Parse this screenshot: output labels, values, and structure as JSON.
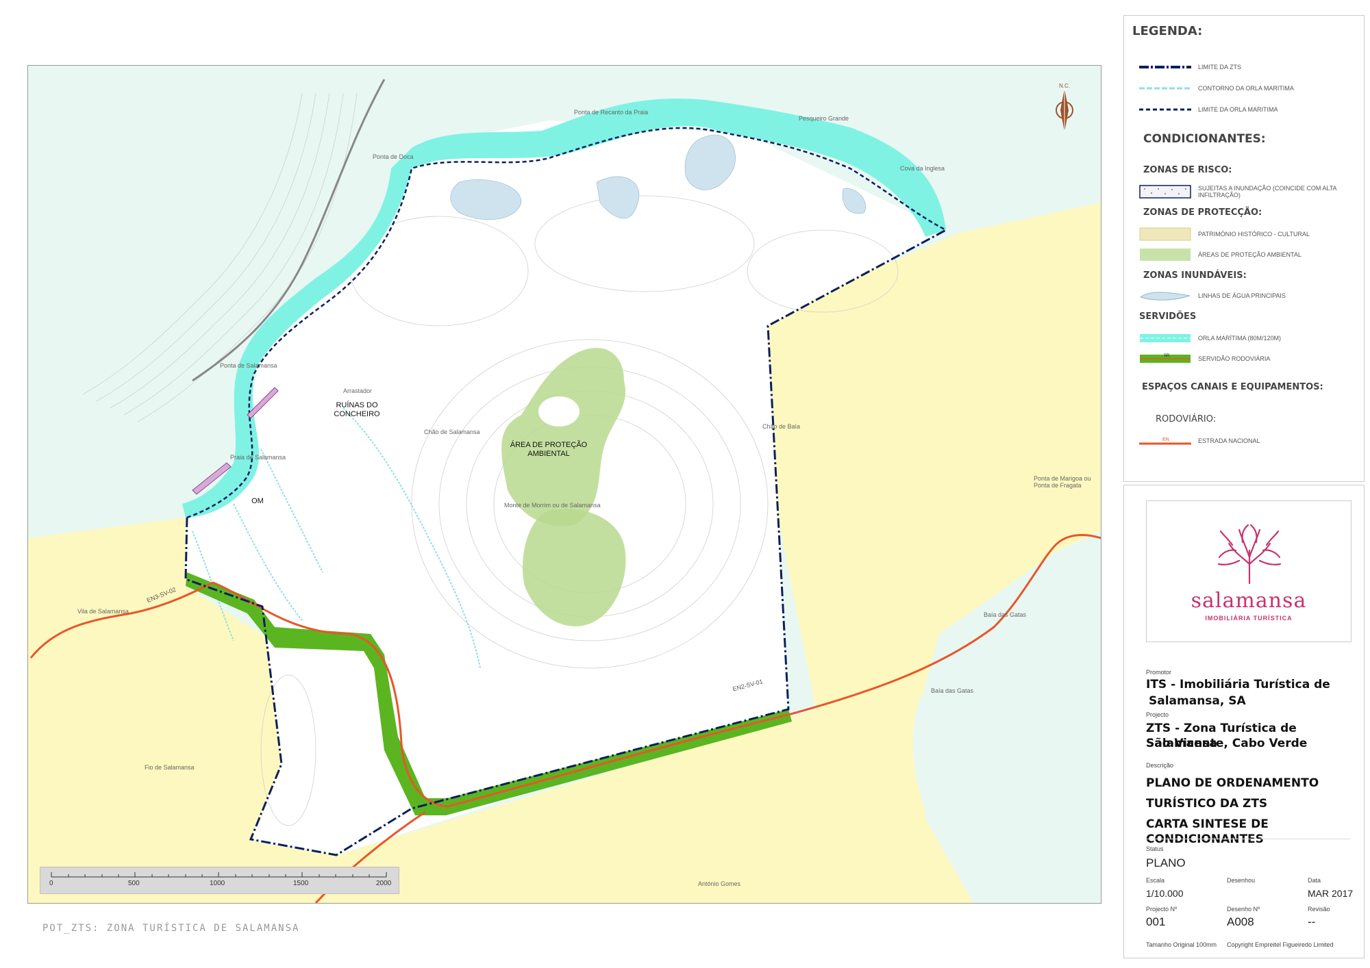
{
  "drawing_title": "POT_ZTS: ZONA TURÍSTICA DE SALAMANSA",
  "north_label": "N.C.",
  "map": {
    "places": {
      "ponta_recanto": "Ponta de Recanto da Praia",
      "pesqueiro": "Pesqueiro Grande",
      "ponta_doca": "Ponta de Doca",
      "cova_inglesa": "Cova da Inglesa",
      "ponta_salamansa": "Ponta de Salamansa",
      "arrastador": "Arrastador",
      "chao_salamansa": "Chão de Salamansa",
      "chao_baia": "Chão de Baía",
      "praia_salamansa": "Praia de Salamansa",
      "monte": "Monte de Morrim ou de Salamansa",
      "ponta_marigoa": "Ponta de Marigoa ou Ponta de Fragata",
      "vila": "Vila de Salamansa",
      "baia_gatas_1": "Baía das Gatas",
      "baia_gatas_2": "Baía das Gatas",
      "fio": "Fio de Salamansa",
      "antonio": "António Gomes"
    },
    "labels": {
      "ruinas": "RUÍNAS DO CONCHEIRO",
      "area_protecao": "ÁREA DE PROTEÇÃO AMBIENTAL",
      "om": "OM"
    },
    "roads": {
      "en3": "EN3-SV-02",
      "en2": "EN2-SV-01"
    },
    "scale_ticks": [
      "0",
      "500",
      "1000",
      "1500",
      "2000"
    ]
  },
  "legend": {
    "title": "LEGENDA:",
    "items_top": [
      {
        "label": "LIMITE DA ZTS"
      },
      {
        "label": "CONTORNO DA ORLA MARITIMA"
      },
      {
        "label": "LIMITE DA ORLA MARITIMA"
      }
    ],
    "condicionantes": "CONDICIONANTES:",
    "zonas_risco": "ZONAS DE RISCO:",
    "risco_item": "SUJEITAS A INUNDAÇÃO (COINCIDE COM ALTA INFILTRAÇÃO)",
    "zonas_protecao": "ZONAS DE PROTECÇÃO:",
    "patrimonio": "PATRIMÓNIO HISTÓRICO - CULTURAL",
    "areas_protecao": "ÁREAS DE PROTEÇÃO AMBIENTAL",
    "zonas_inundaveis": "ZONAS INUNDÁVEIS:",
    "linhas_agua": "LINHAS DE ÁGUA PRINCIPAIS",
    "servidoes": "SERVIDÕES",
    "orla": "ORLA MARÍTIMA (80m/120m)",
    "servidao_rod": "SERVIDÃO RODOVIÁRIA",
    "sr_tag": "SR",
    "espacos": "ESPAÇOS CANAIS E EQUIPAMENTOS:",
    "rodoviario": "RODOVIÁRIO:",
    "estrada": "ESTRADA NACIONAL",
    "en_tag": "EN"
  },
  "titleblock": {
    "logo_name": "salamansa",
    "logo_sub": "IMOBILIÁRIA TURÍSTICA",
    "promotor_label": "Promotor",
    "promotor_line1": "ITS - Imobiliária Turística de",
    "promotor_line2": "Salamansa, SA",
    "projecto_label": "Projecto",
    "projecto_line1": "ZTS - Zona Turística de Salamansa",
    "projecto_line2": "São Vicente, Cabo Verde",
    "descricao_label": "Descrição",
    "descricao_line1": "PLANO DE ORDENAMENTO",
    "descricao_line2": "TURÍSTICO DA ZTS",
    "descricao_line3": "CARTA SINTESE DE CONDICIONANTES",
    "status_label": "Status",
    "status": "PLANO",
    "escala_label": "Escala",
    "escala": "1/10.000",
    "desenhou_label": "Desenhou",
    "data_label": "Data",
    "data": "MAR 2017",
    "projecto_no_label": "Projecto Nº",
    "projecto_no": "001",
    "desenho_no_label": "Desenho Nº",
    "desenho_no": "A008",
    "revisao_label": "Revisão",
    "revisao": "--",
    "tamanho": "Tamanho Original 100mm",
    "copyright": "Copyright Empreitel Figueiredo Limited"
  },
  "colors": {
    "sea": "#e8f7f2",
    "land": "#fdf8bf",
    "orla": "#7ff2e3",
    "zts_limit": "#0d1f5c",
    "protecao": "#b8d98f",
    "servidao": "#5bb521",
    "road": "#e8562a",
    "water": "#cfe3ee"
  }
}
